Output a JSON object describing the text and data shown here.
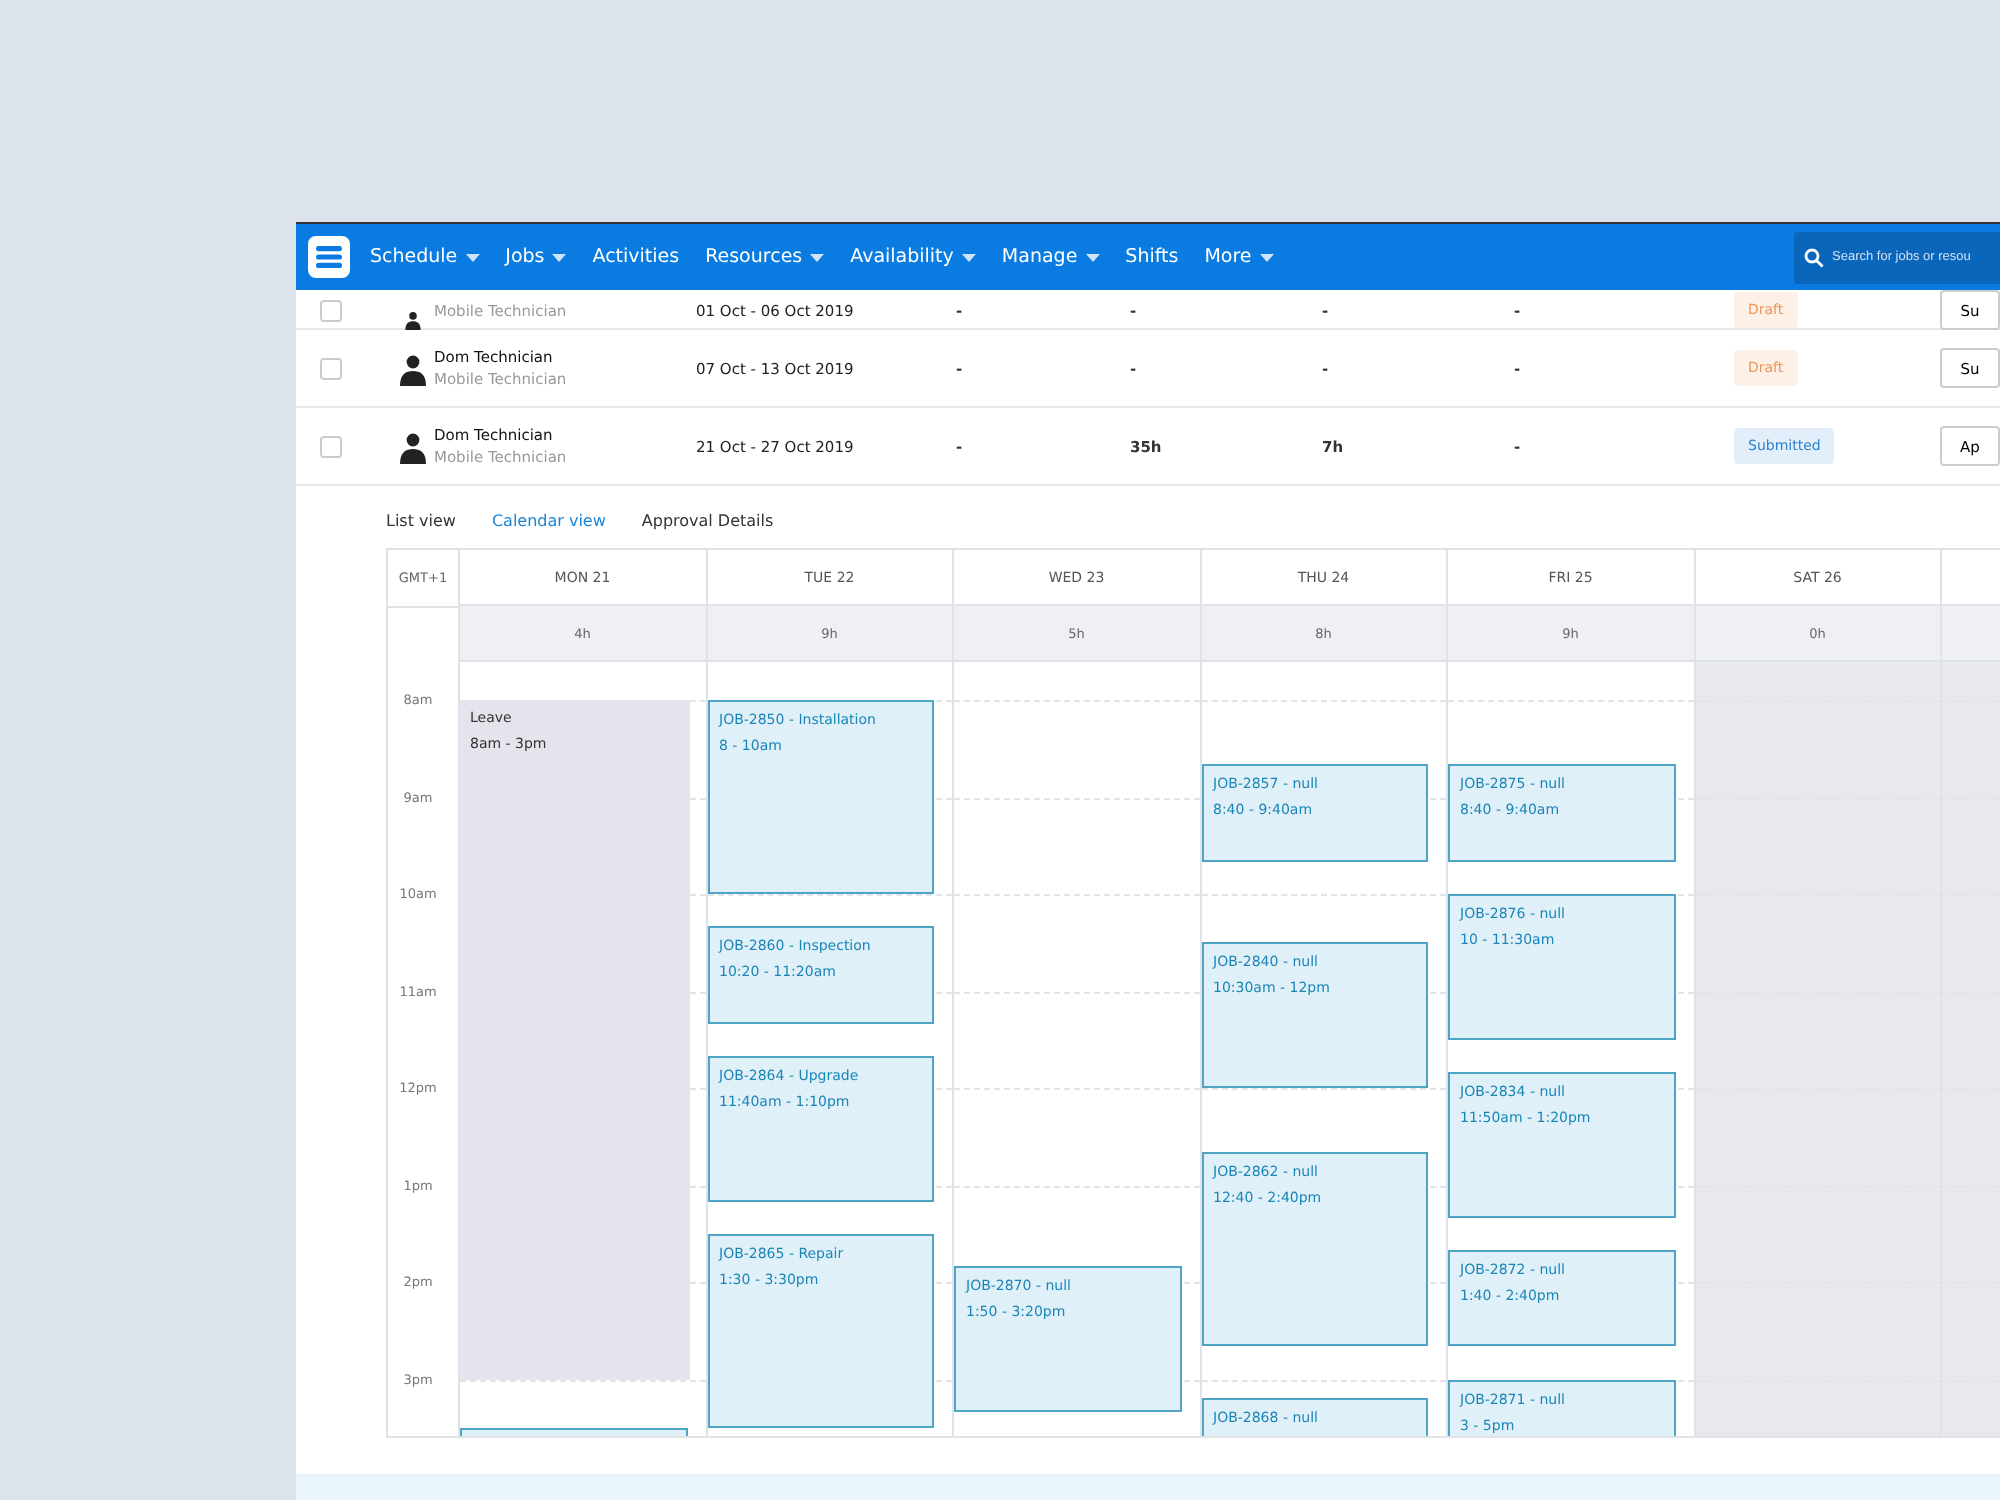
{
  "nav": {
    "items": [
      {
        "label": "Schedule",
        "has_menu": true
      },
      {
        "label": "Jobs",
        "has_menu": true
      },
      {
        "label": "Activities",
        "has_menu": false
      },
      {
        "label": "Resources",
        "has_menu": true
      },
      {
        "label": "Availability",
        "has_menu": true
      },
      {
        "label": "Manage",
        "has_menu": true
      },
      {
        "label": "Shifts",
        "has_menu": false
      },
      {
        "label": "More",
        "has_menu": true
      }
    ],
    "search": {
      "placeholder": "Search for jobs or resou"
    }
  },
  "timesheets": [
    {
      "checked": false,
      "role": "Mobile Technician",
      "period": "01 Oct - 06 Oct 2019",
      "column_3": "-",
      "column_4": "-",
      "column_5": "-",
      "column_6": "-",
      "status": {
        "label": "Draft",
        "kind": "draft"
      },
      "action": "Su"
    },
    {
      "checked": false,
      "name": "Dom Technician",
      "role": "Mobile Technician",
      "period": "07 Oct - 13 Oct 2019",
      "column_3": "-",
      "column_4": "-",
      "column_5": "-",
      "column_6": "-",
      "status": {
        "label": "Draft",
        "kind": "draft"
      },
      "action": "Su"
    },
    {
      "checked": false,
      "name": "Dom Technician",
      "role": "Mobile Technician",
      "period": "21 Oct - 27 Oct 2019",
      "column_3": "-",
      "column_4": "35h",
      "column_5": "7h",
      "column_6": "-",
      "status": {
        "label": "Submitted",
        "kind": "submitted"
      },
      "action": "Ap"
    }
  ],
  "view_tabs": [
    {
      "label": "List view",
      "selected": false
    },
    {
      "label": "Calendar view",
      "selected": true
    },
    {
      "label": "Approval Details",
      "selected": false
    }
  ],
  "calendar": {
    "timezone": "GMT+1",
    "hours": [
      "8am",
      "9am",
      "10am",
      "11am",
      "12pm",
      "1pm",
      "2pm",
      "3pm"
    ],
    "days": [
      {
        "label": "MON 21",
        "total": "4h",
        "weekend": false,
        "events": [
          {
            "kind": "leave",
            "title": "Leave",
            "time": "8am - 3pm"
          },
          {
            "kind": "job"
          }
        ]
      },
      {
        "label": "TUE 22",
        "total": "9h",
        "weekend": false,
        "events": [
          {
            "kind": "job",
            "title": "JOB-2850 - Installation",
            "time": "8 - 10am"
          },
          {
            "kind": "job",
            "title": "JOB-2860 - Inspection",
            "time": "10:20 - 11:20am"
          },
          {
            "kind": "job",
            "title": "JOB-2864 - Upgrade",
            "time": "11:40am - 1:10pm"
          },
          {
            "kind": "job",
            "title": "JOB-2865 - Repair",
            "time": "1:30 - 3:30pm"
          }
        ]
      },
      {
        "label": "WED 23",
        "total": "5h",
        "weekend": false,
        "events": [
          {
            "kind": "job",
            "title": "JOB-2870 - null",
            "time": "1:50 - 3:20pm"
          }
        ]
      },
      {
        "label": "THU 24",
        "total": "8h",
        "weekend": false,
        "events": [
          {
            "kind": "job",
            "title": "JOB-2857 - null",
            "time": "8:40 - 9:40am"
          },
          {
            "kind": "job",
            "title": "JOB-2840 - null",
            "time": "10:30am - 12pm"
          },
          {
            "kind": "job",
            "title": "JOB-2862 - null",
            "time": "12:40 - 2:40pm"
          },
          {
            "kind": "job",
            "title": "JOB-2868 - null"
          }
        ]
      },
      {
        "label": "FRI 25",
        "total": "9h",
        "weekend": false,
        "events": [
          {
            "kind": "job",
            "title": "JOB-2875 - null",
            "time": "8:40 - 9:40am"
          },
          {
            "kind": "job",
            "title": "JOB-2876 - null",
            "time": "10 - 11:30am"
          },
          {
            "kind": "job",
            "title": "JOB-2834 - null",
            "time": "11:50am - 1:20pm"
          },
          {
            "kind": "job",
            "title": "JOB-2872 - null",
            "time": "1:40 - 2:40pm"
          },
          {
            "kind": "job",
            "title": "JOB-2871 - null",
            "time": "3 - 5pm"
          }
        ]
      },
      {
        "label": "SAT 26",
        "total": "0h",
        "weekend": true
      },
      {
        "weekend": true
      }
    ]
  }
}
